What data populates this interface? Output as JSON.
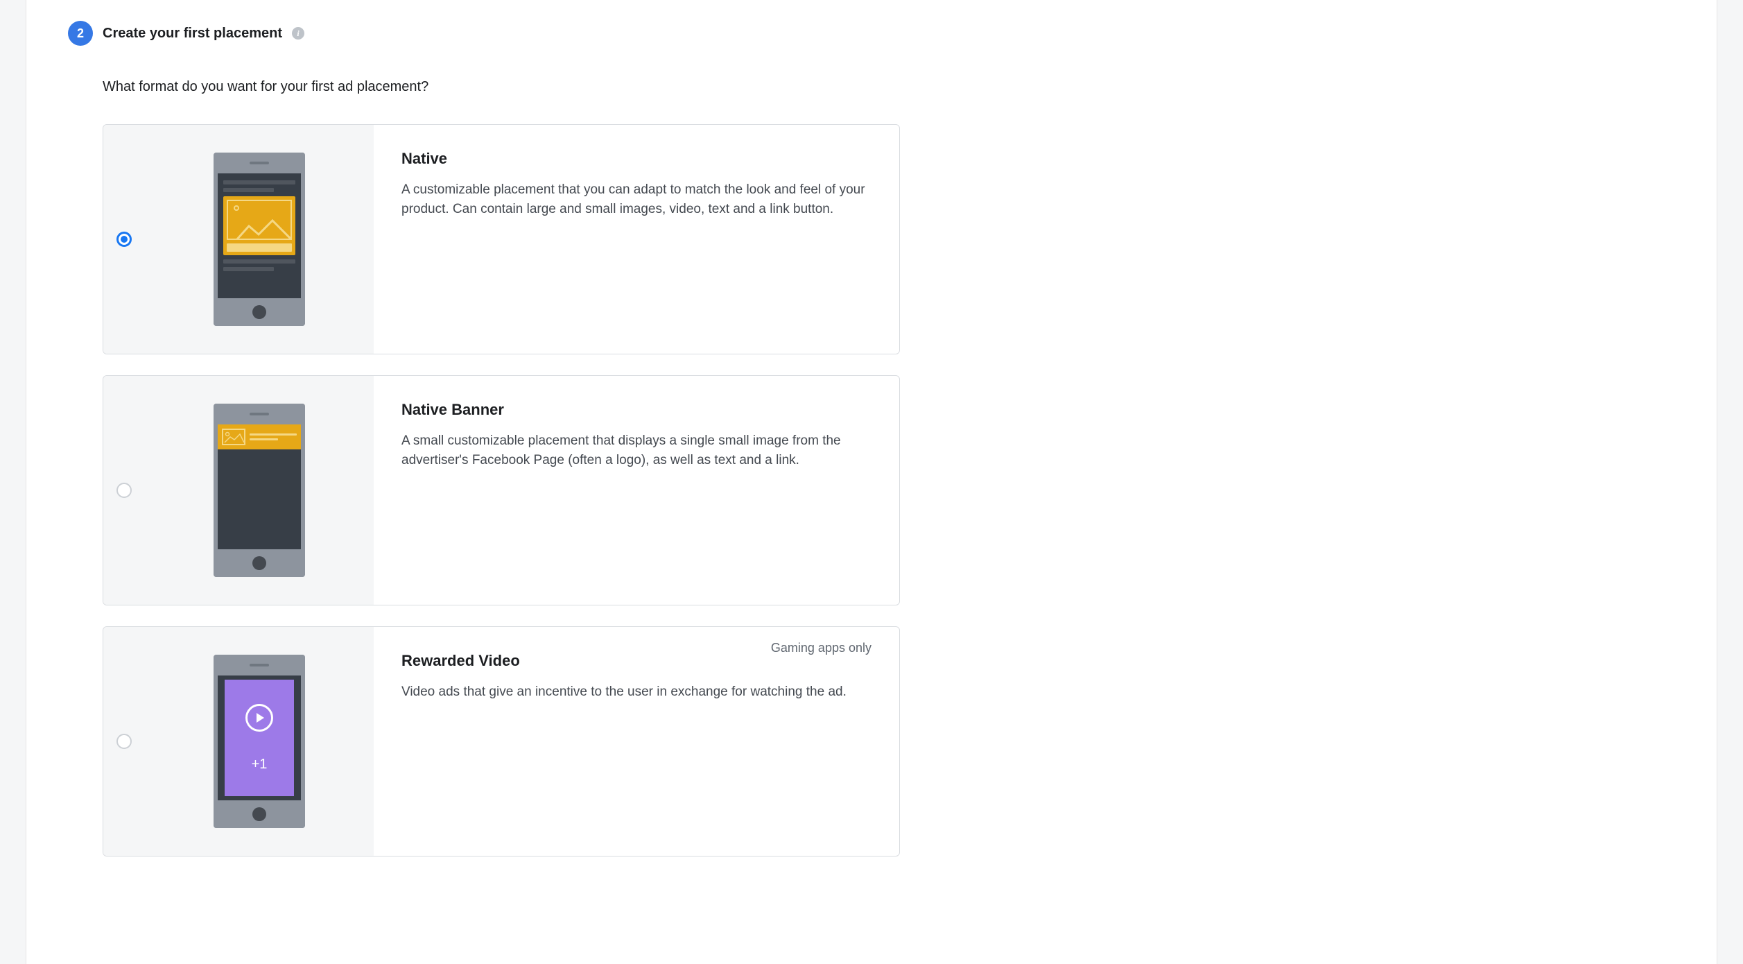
{
  "step": {
    "number": "2",
    "title": "Create your first placement"
  },
  "question": "What format do you want for your first ad placement?",
  "options": [
    {
      "id": "native",
      "title": "Native",
      "description": "A customizable placement that you can adapt to match the look and feel of your product. Can contain large and small images, video, text and a link button.",
      "selected": true,
      "badge": ""
    },
    {
      "id": "native-banner",
      "title": "Native Banner",
      "description": "A small customizable placement that displays a single small image from the advertiser's Facebook Page (often a logo), as well as text and a link.",
      "selected": false,
      "badge": ""
    },
    {
      "id": "rewarded-video",
      "title": "Rewarded Video",
      "description": "Video ads that give an incentive to the user in exchange for watching the ad.",
      "selected": false,
      "badge": "Gaming apps only",
      "plus_label": "+1"
    }
  ]
}
